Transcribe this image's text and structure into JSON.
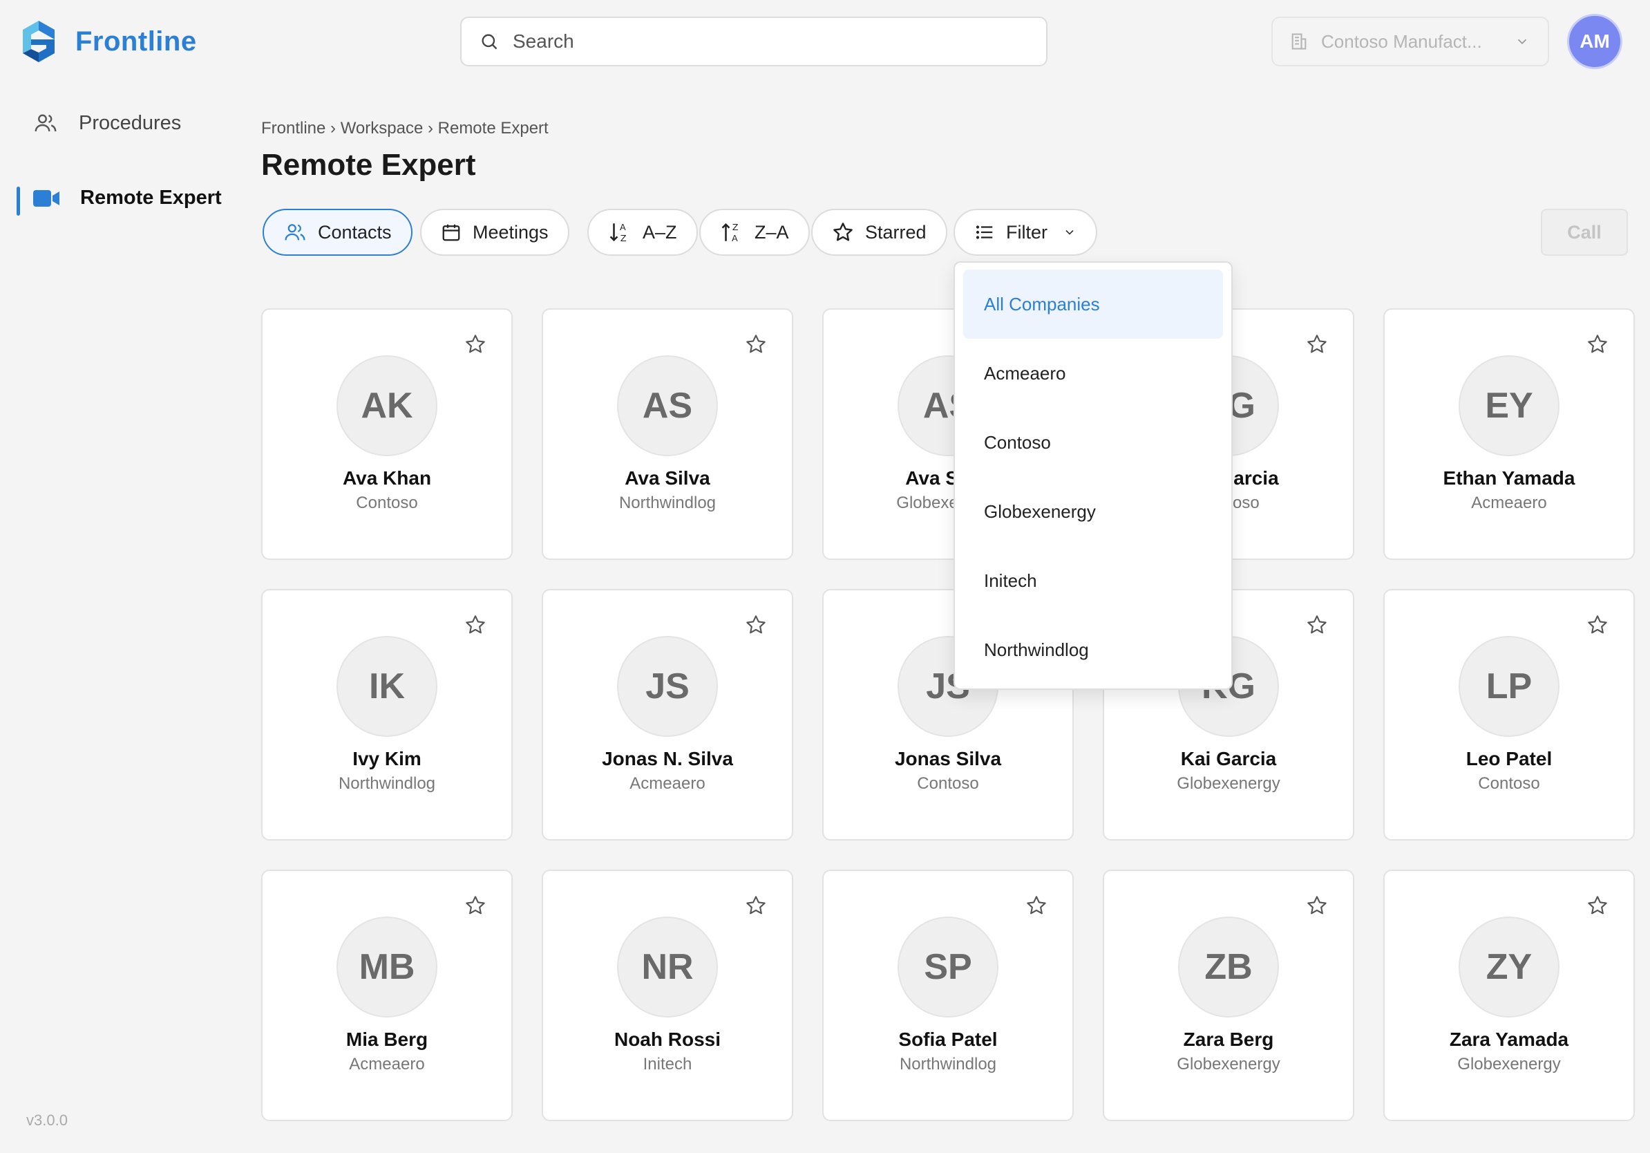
{
  "app": {
    "name": "Frontline",
    "version": "v3.0.0"
  },
  "header": {
    "search_placeholder": "Search",
    "company_select": "Contoso Manufact...",
    "user_initials": "AM"
  },
  "sidebar": {
    "items": [
      {
        "label": "Procedures",
        "icon": "users-icon",
        "active": false
      },
      {
        "label": "Remote Expert",
        "icon": "video-camera-icon",
        "active": true
      }
    ]
  },
  "breadcrumb": "Frontline › Workspace › Remote Expert",
  "page_title": "Remote Expert",
  "toolbar": {
    "contacts": "Contacts",
    "meetings": "Meetings",
    "sort_az": "A–Z",
    "sort_za": "Z–A",
    "starred": "Starred",
    "filter": "Filter",
    "call": "Call"
  },
  "colors": {
    "accent": "#2b7fd4",
    "avatar_me": "#7b88f2"
  },
  "filter_dropdown": {
    "selected": "All Companies",
    "options": [
      "All Companies",
      "Acmeaero",
      "Contoso",
      "Globexenergy",
      "Initech",
      "Northwindlog"
    ]
  },
  "contacts": [
    {
      "initials": "AK",
      "name": "Ava Khan",
      "company": "Contoso"
    },
    {
      "initials": "AS",
      "name": "Ava Silva",
      "company": "Northwindlog"
    },
    {
      "initials": "AS",
      "name": "Ava Silva",
      "company": "Globexenergy"
    },
    {
      "initials": "AG",
      "name": "Ava Garcia",
      "company": "Contoso"
    },
    {
      "initials": "EY",
      "name": "Ethan Yamada",
      "company": "Acmeaero"
    },
    {
      "initials": "IK",
      "name": "Ivy Kim",
      "company": "Northwindlog"
    },
    {
      "initials": "JS",
      "name": "Jonas N. Silva",
      "company": "Acmeaero"
    },
    {
      "initials": "JS",
      "name": "Jonas Silva",
      "company": "Contoso"
    },
    {
      "initials": "KG",
      "name": "Kai Garcia",
      "company": "Globexenergy"
    },
    {
      "initials": "LP",
      "name": "Leo Patel",
      "company": "Contoso"
    },
    {
      "initials": "MB",
      "name": "Mia Berg",
      "company": "Acmeaero"
    },
    {
      "initials": "NR",
      "name": "Noah Rossi",
      "company": "Initech"
    },
    {
      "initials": "SP",
      "name": "Sofia Patel",
      "company": "Northwindlog"
    },
    {
      "initials": "ZB",
      "name": "Zara Berg",
      "company": "Globexenergy"
    },
    {
      "initials": "ZY",
      "name": "Zara Yamada",
      "company": "Globexenergy"
    }
  ]
}
